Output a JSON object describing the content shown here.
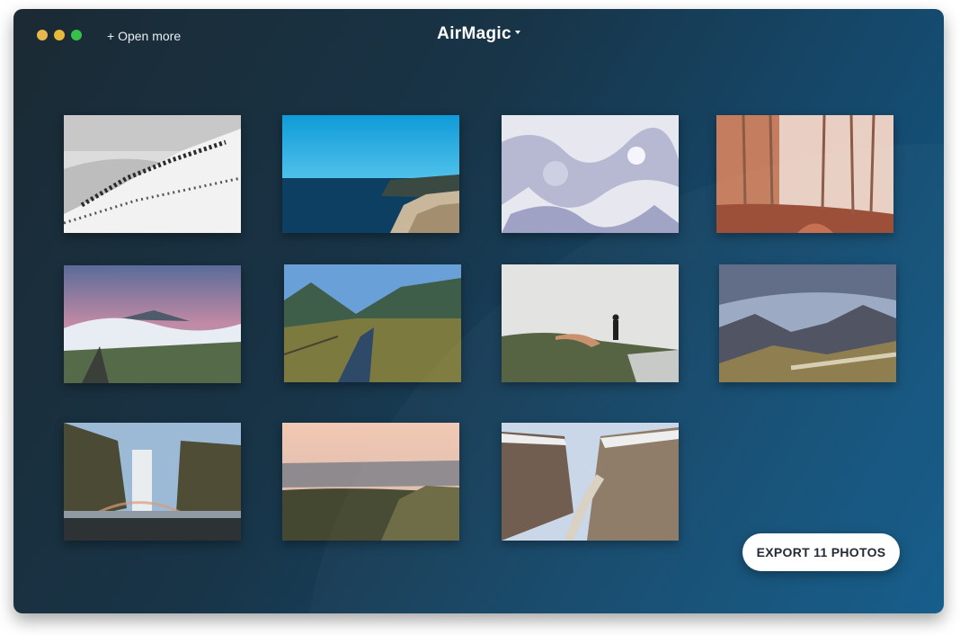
{
  "window": {
    "title": "AirMagic",
    "open_more": "+ Open more"
  },
  "photos": [
    {
      "name": "snowy-mountain-fog"
    },
    {
      "name": "sea-cliff-blue-sky"
    },
    {
      "name": "snow-texture"
    },
    {
      "name": "misty-forest"
    },
    {
      "name": "volcano-clouds"
    },
    {
      "name": "valley-stream"
    },
    {
      "name": "person-on-cliff"
    },
    {
      "name": "mountain-ridge"
    },
    {
      "name": "waterfall-rainbow"
    },
    {
      "name": "hills-sunset"
    },
    {
      "name": "canyon-cliffs"
    }
  ],
  "export": {
    "label": "EXPORT 11 PHOTOS"
  }
}
